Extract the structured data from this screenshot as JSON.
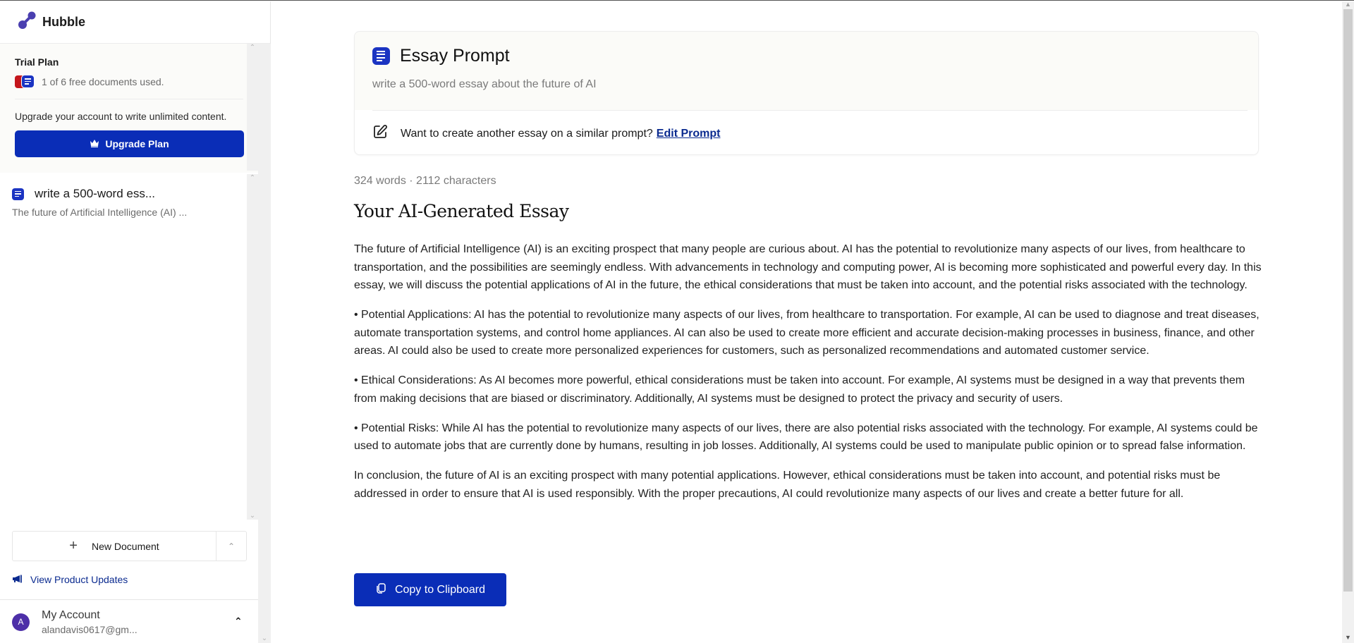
{
  "app": {
    "name": "Hubble",
    "brand_color": "#0a2db7",
    "logo_icon": "molecule-icon"
  },
  "sidebar": {
    "trial": {
      "title": "Trial Plan",
      "usage_text": "1 of 6 free documents used.",
      "used": 1,
      "total": 6,
      "upgrade_note": "Upgrade your account to write unlimited content.",
      "upgrade_button": "Upgrade Plan",
      "upgrade_icon": "crown-icon"
    },
    "documents": [
      {
        "title": "write a 500-word ess...",
        "snippet": "The future of Artificial Intelligence (AI) ...",
        "icon": "document-icon"
      }
    ],
    "new_document_button": "New Document",
    "new_document_icon": "plus-icon",
    "product_updates_link": "View Product Updates",
    "product_updates_icon": "megaphone-icon",
    "account": {
      "avatar_letter": "A",
      "label": "My Account",
      "email": "alandavis0617@gm..."
    }
  },
  "main": {
    "prompt_card": {
      "title": "Essay Prompt",
      "prompt_text": "write a 500-word essay about the future of AI",
      "cta_text": "Want to create another essay on a similar prompt?",
      "edit_link": "Edit Prompt"
    },
    "stats": "324 words · 2112 characters",
    "essay_title": "Your AI-Generated Essay",
    "essay_paragraphs": [
      "The future of Artificial Intelligence (AI) is an exciting prospect that many people are curious about. AI has the potential to revolutionize many aspects of our lives, from healthcare to transportation, and the possibilities are seemingly endless. With advancements in technology and computing power, AI is becoming more sophisticated and powerful every day. In this essay, we will discuss the potential applications of AI in the future, the ethical considerations that must be taken into account, and the potential risks associated with the technology.",
      "• Potential Applications: AI has the potential to revolutionize many aspects of our lives, from healthcare to transportation. For example, AI can be used to diagnose and treat diseases, automate transportation systems, and control home appliances. AI can also be used to create more efficient and accurate decision-making processes in business, finance, and other areas. AI could also be used to create more personalized experiences for customers, such as personalized recommendations and automated customer service.",
      "• Ethical Considerations: As AI becomes more powerful, ethical considerations must be taken into account. For example, AI systems must be designed in a way that prevents them from making decisions that are biased or discriminatory. Additionally, AI systems must be designed to protect the privacy and security of users.",
      "• Potential Risks: While AI has the potential to revolutionize many aspects of our lives, there are also potential risks associated with the technology. For example, AI systems could be used to automate jobs that are currently done by humans, resulting in job losses. Additionally, AI systems could be used to manipulate public opinion or to spread false information.",
      "In conclusion, the future of AI is an exciting prospect with many potential applications. However, ethical considerations must be taken into account, and potential risks must be addressed in order to ensure that AI is used responsibly. With the proper precautions, AI could revolutionize many aspects of our lives and create a better future for all."
    ],
    "copy_button": "Copy to Clipboard"
  }
}
